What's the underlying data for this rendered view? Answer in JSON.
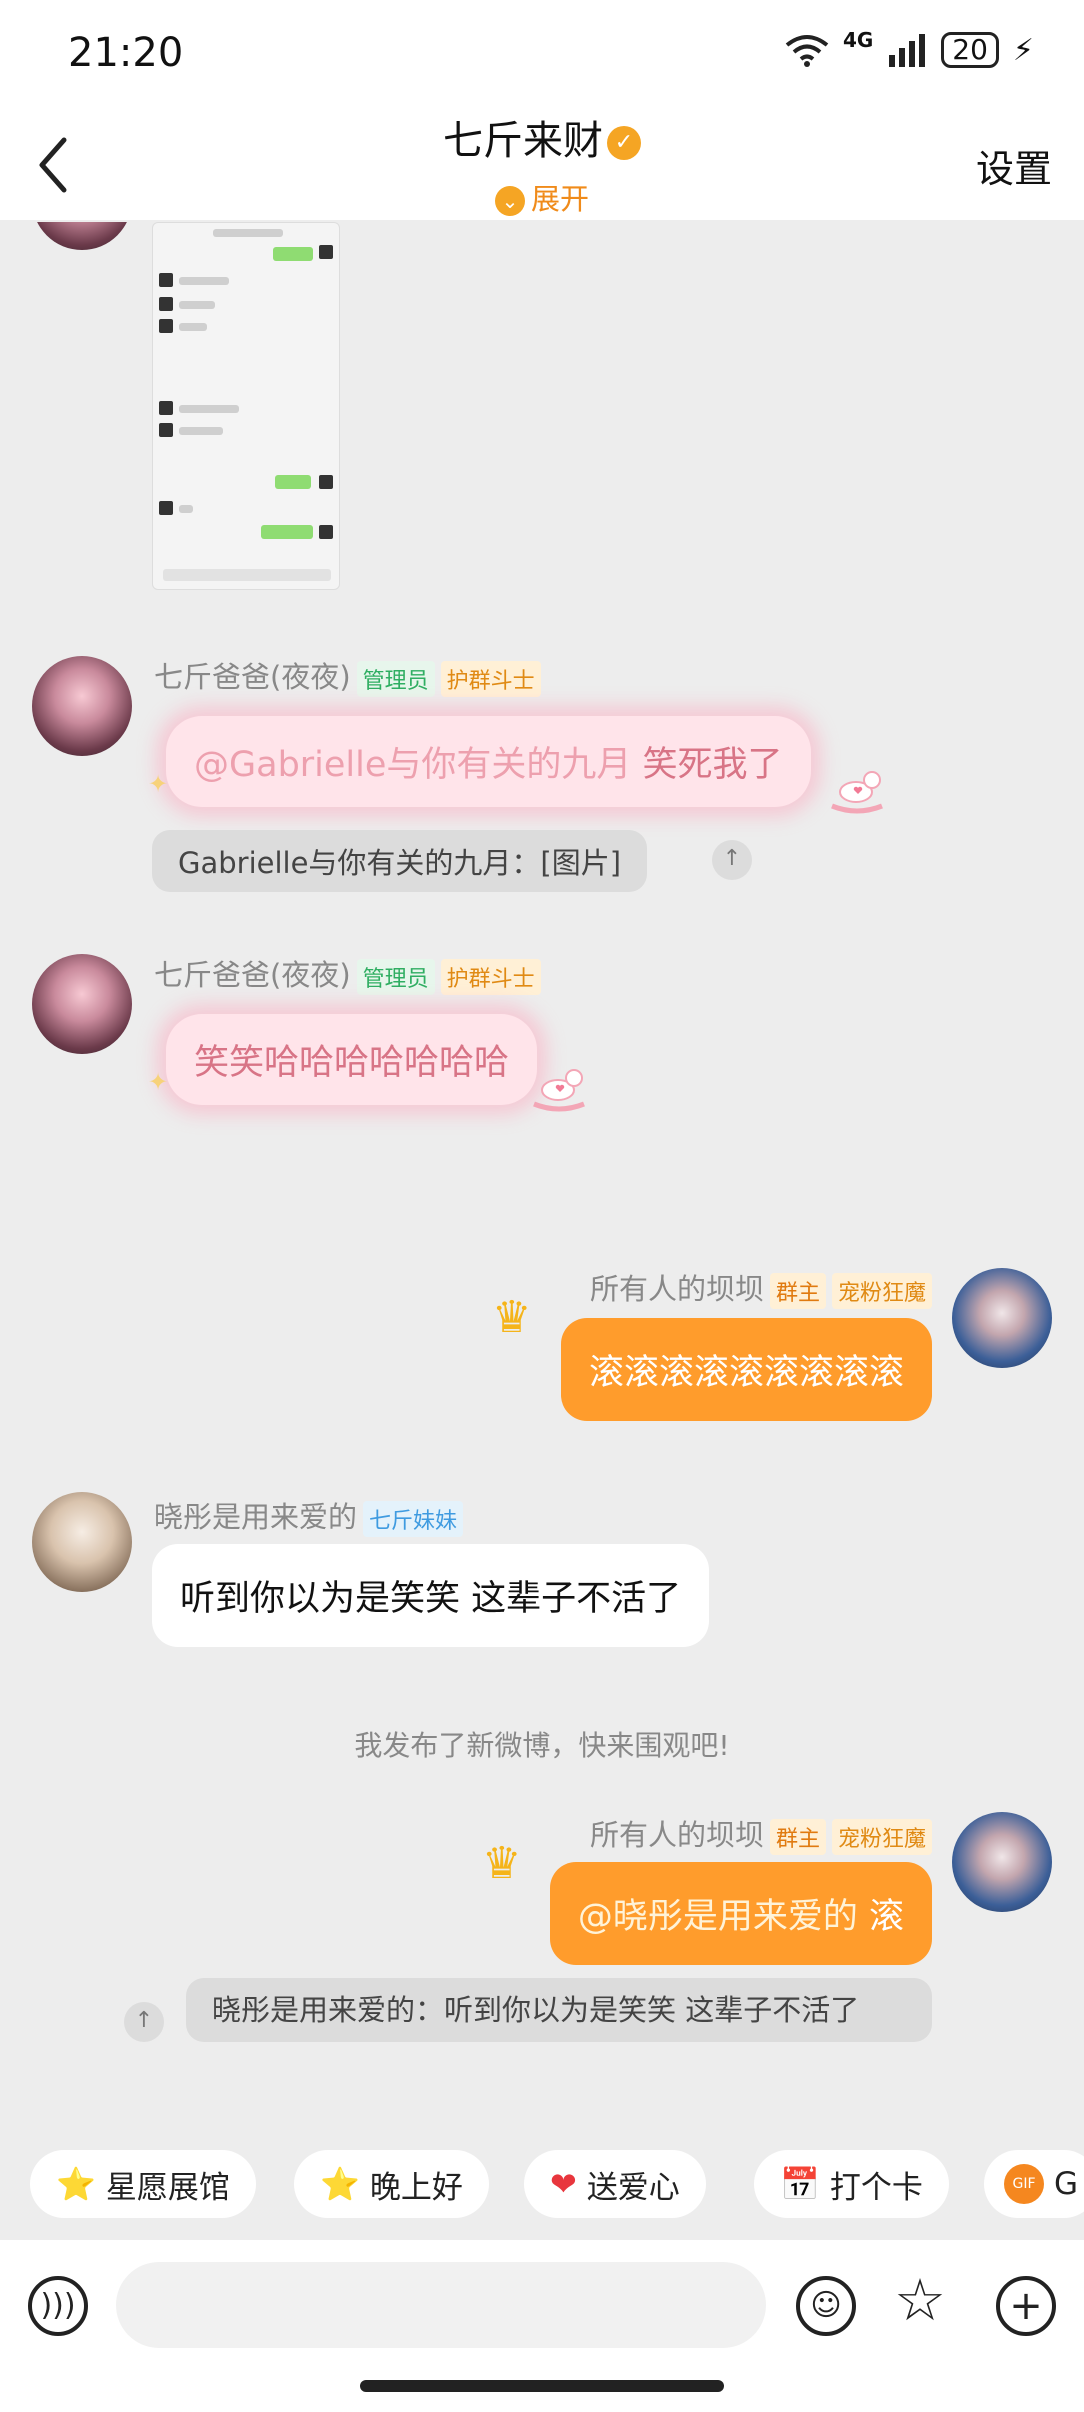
{
  "status_bar": {
    "time": "21:20",
    "network": "4G",
    "battery": "20"
  },
  "header": {
    "title": "七斤来财",
    "expand_label": "展开",
    "settings_label": "设置"
  },
  "messages": [
    {
      "sender": "七斤爸爸(夜夜)",
      "tags": [
        "管理员",
        "护群斗士"
      ],
      "mention": "@Gabrielle与你有关的九月",
      "text": " 笑死我了",
      "quote": "Gabrielle与你有关的九月：[图片]"
    },
    {
      "sender": "七斤爸爸(夜夜)",
      "tags": [
        "管理员",
        "护群斗士"
      ],
      "text": "笑笑哈哈哈哈哈哈哈"
    },
    {
      "sender": "所有人的坝坝",
      "tags": [
        "群主",
        "宠粉狂魔"
      ],
      "text": "滚滚滚滚滚滚滚滚滚"
    },
    {
      "sender": "晓彤是用来爱的",
      "tags": [
        "七斤妹妹"
      ],
      "text": "听到你以为是笑笑 这辈子不活了"
    },
    {
      "sender": "所有人的坝坝",
      "tags": [
        "群主",
        "宠粉狂魔"
      ],
      "mention": "@晓彤是用来爱的",
      "text": " 滚",
      "quote": "晓彤是用来爱的：听到你以为是笑笑 这辈子不活了"
    }
  ],
  "system_message": "我发布了新微博，快来围观吧!",
  "quick_chips": [
    {
      "label": "星愿展馆",
      "icon": "star"
    },
    {
      "label": "晚上好",
      "icon": "star"
    },
    {
      "label": "送爱心",
      "icon": "heart"
    },
    {
      "label": "打个卡",
      "icon": "calendar"
    },
    {
      "label": "G",
      "icon": "gif"
    }
  ],
  "colors": {
    "accent": "#ff9c2c",
    "orange_text": "#f08b1a",
    "admin_green": "#2fae62"
  }
}
